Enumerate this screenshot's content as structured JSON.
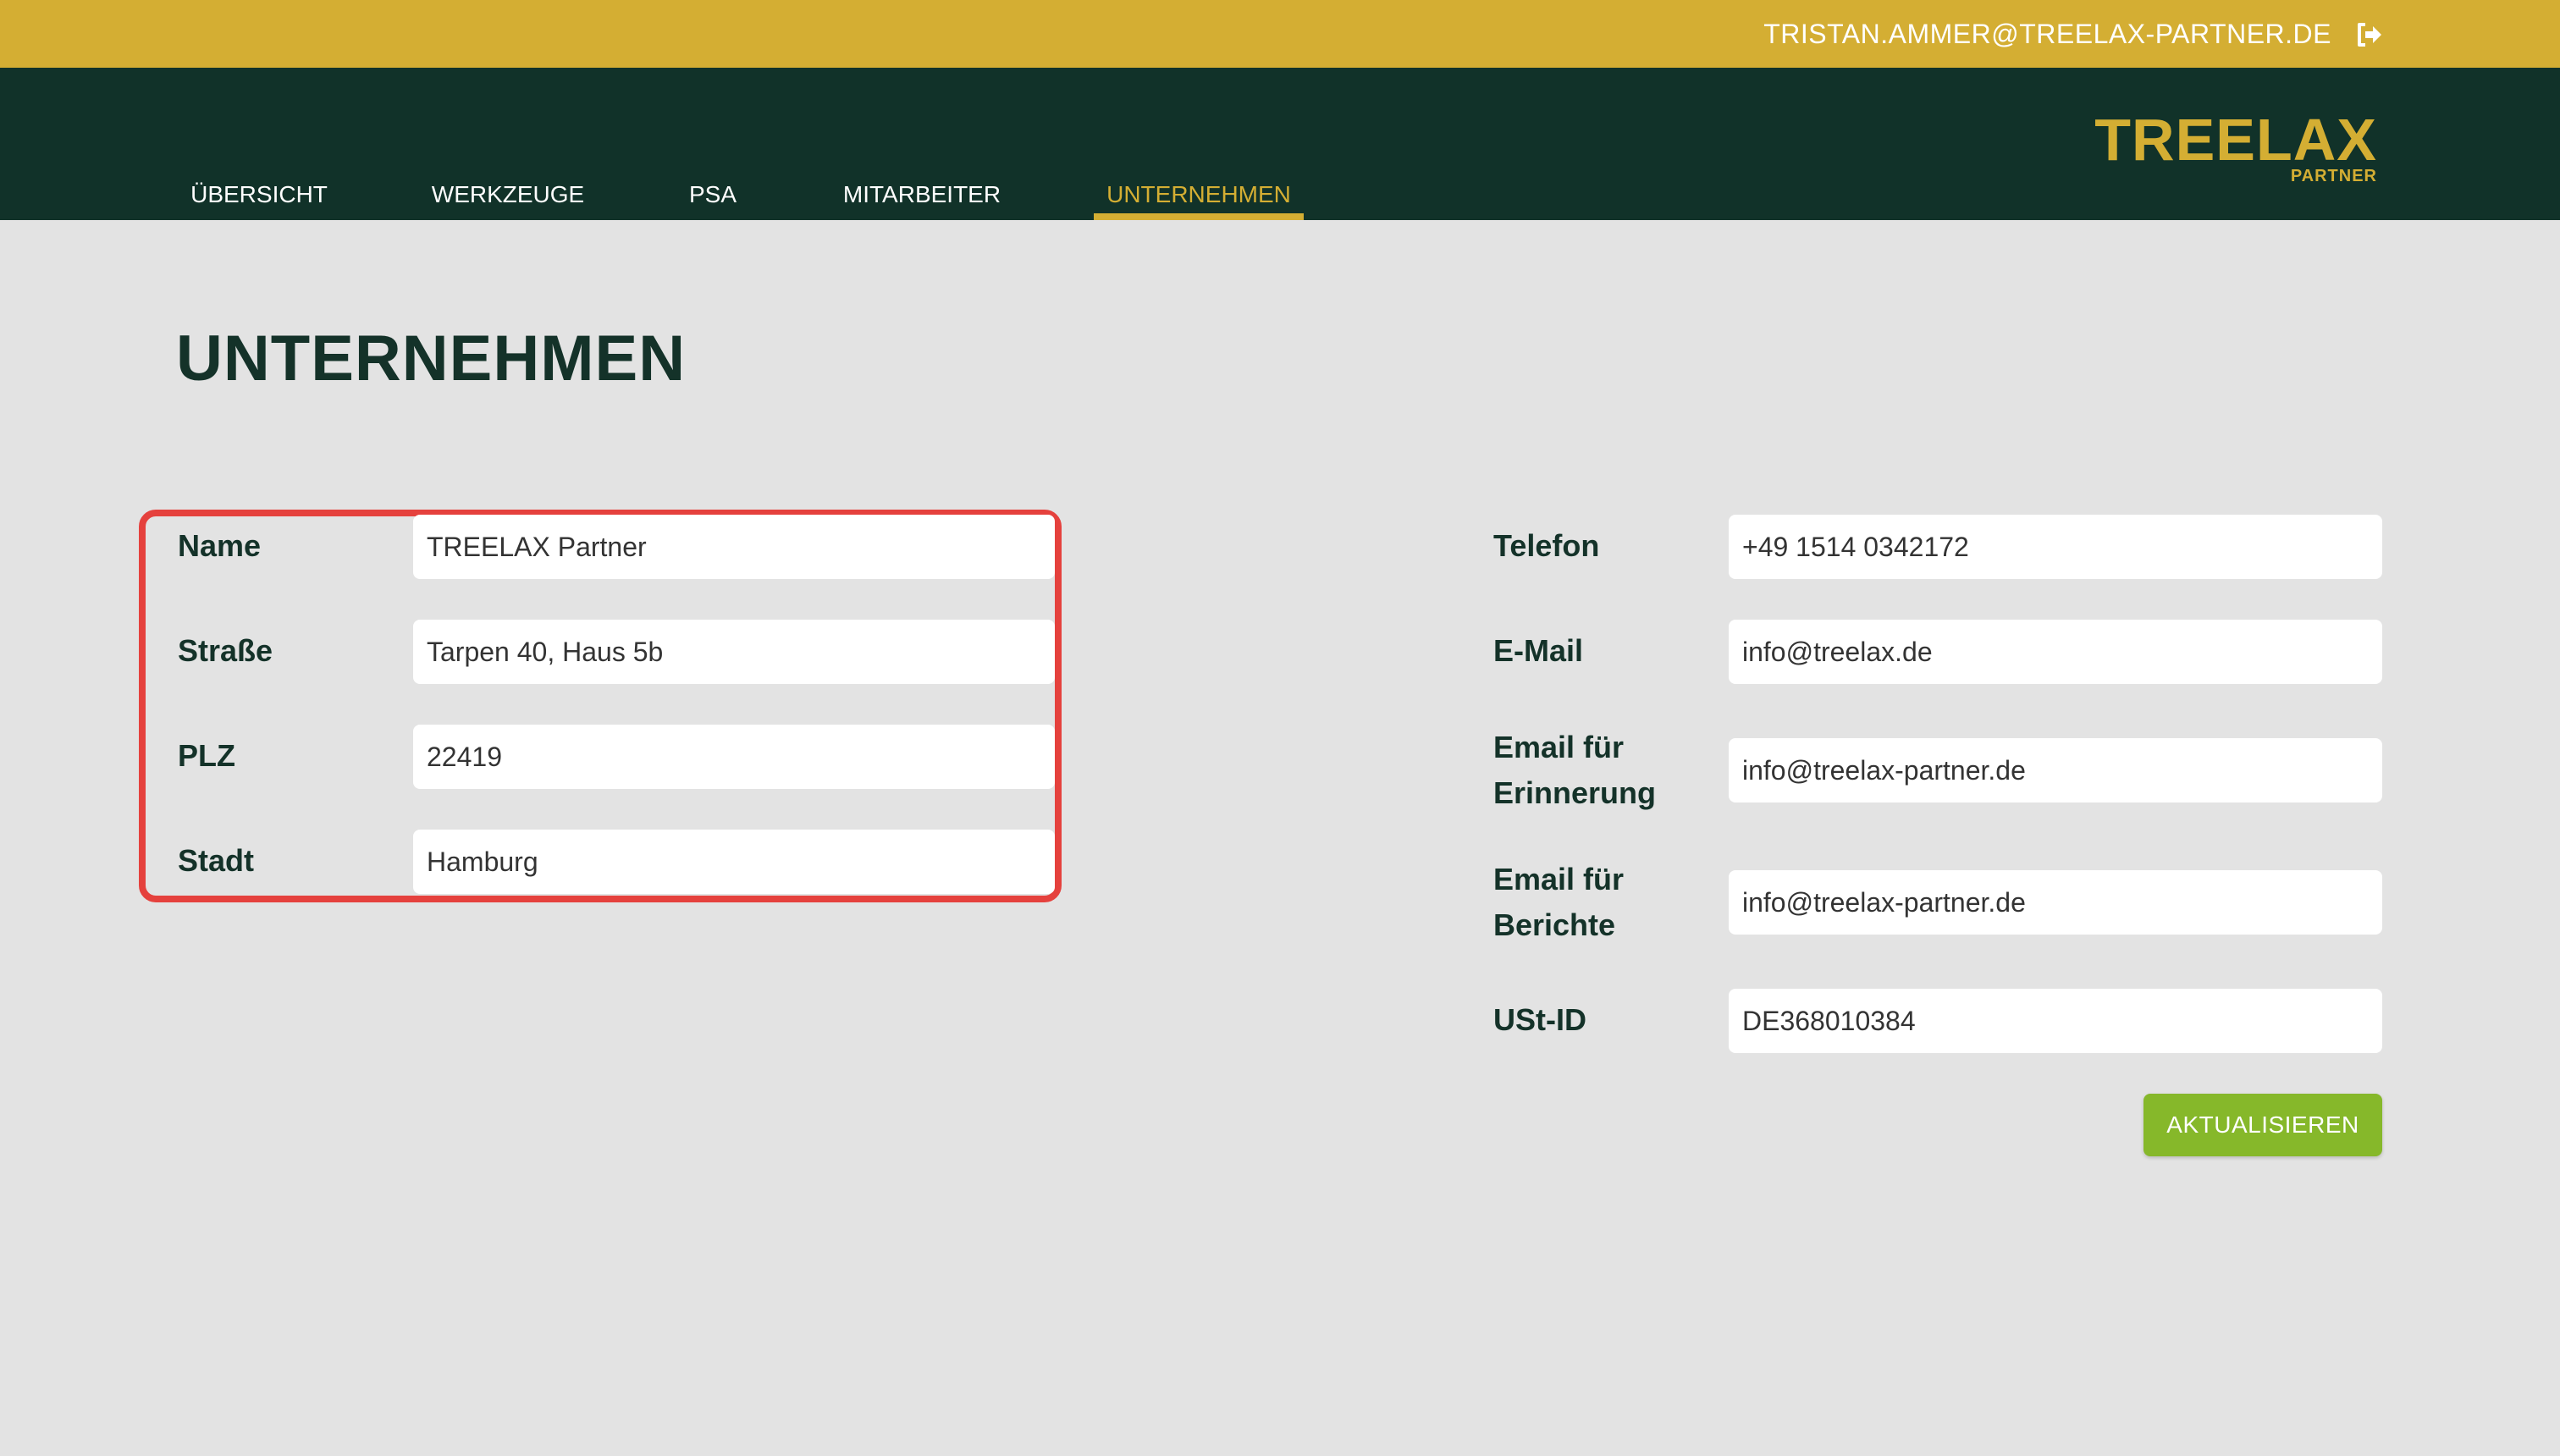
{
  "header": {
    "user_email": "TRISTAN.AMMER@TREELAX-PARTNER.DE",
    "logout_icon": "logout-icon"
  },
  "nav": {
    "tabs": [
      {
        "label": "ÜBERSICHT",
        "active": false
      },
      {
        "label": "WERKZEUGE",
        "active": false
      },
      {
        "label": "PSA",
        "active": false
      },
      {
        "label": "MITARBEITER",
        "active": false
      },
      {
        "label": "UNTERNEHMEN",
        "active": true
      }
    ],
    "logo_main": "TREELAX",
    "logo_sub": "PARTNER"
  },
  "page": {
    "title": "UNTERNEHMEN"
  },
  "form": {
    "left": [
      {
        "label": "Name",
        "value": "TREELAX Partner"
      },
      {
        "label": "Straße",
        "value": "Tarpen 40, Haus 5b"
      },
      {
        "label": "PLZ",
        "value": "22419"
      },
      {
        "label": "Stadt",
        "value": "Hamburg"
      }
    ],
    "right": [
      {
        "label": "Telefon",
        "value": "+49 1514 0342172"
      },
      {
        "label": "E-Mail",
        "value": "info@treelax.de"
      },
      {
        "label_line1": "Email für",
        "label_line2": "Erinnerung",
        "value": "info@treelax-partner.de"
      },
      {
        "label_line1": "Email für",
        "label_line2": "Berichte",
        "value": "info@treelax-partner.de"
      },
      {
        "label": "USt-ID",
        "value": "DE368010384"
      }
    ],
    "submit_label": "AKTUALISIEREN"
  },
  "colors": {
    "topbar": "#d4ae33",
    "navbar": "#113229",
    "accent": "#d4ae33",
    "background": "#e3e3e3",
    "highlight": "#e5413d",
    "submit": "#86b82a"
  }
}
